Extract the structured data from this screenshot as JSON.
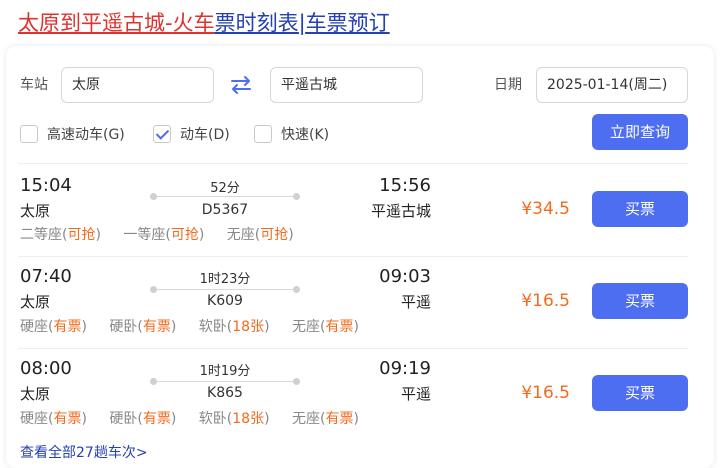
{
  "title": {
    "part1": "太原到平遥古城",
    "dash": "-",
    "part2": "火车",
    "part3": "票时刻表",
    "pipe": "|",
    "part4": "车票预订"
  },
  "search": {
    "station_label": "车站",
    "from": "太原",
    "to": "平遥古城",
    "date_label": "日期",
    "date": "2025-01-14(周二)",
    "button": "立即查询"
  },
  "filters": [
    {
      "label": "高速动车(G)",
      "checked": false
    },
    {
      "label": "动车(D)",
      "checked": true
    },
    {
      "label": "快速(K)",
      "checked": false
    }
  ],
  "trains": [
    {
      "depart_time": "15:04",
      "arrive_time": "15:56",
      "depart_station": "太原",
      "arrive_station": "平遥古城",
      "duration": "52分",
      "number": "D5367",
      "price": "¥34.5",
      "buy": "买票",
      "seats": [
        {
          "name": "二等座",
          "open": "(",
          "status": "可抢",
          "close": ")"
        },
        {
          "name": "一等座",
          "open": "(",
          "status": "可抢",
          "close": ")"
        },
        {
          "name": "无座",
          "open": "(",
          "status": "可抢",
          "close": ")"
        }
      ]
    },
    {
      "depart_time": "07:40",
      "arrive_time": "09:03",
      "depart_station": "太原",
      "arrive_station": "平遥",
      "duration": "1时23分",
      "number": "K609",
      "price": "¥16.5",
      "buy": "买票",
      "seats": [
        {
          "name": "硬座",
          "open": "(",
          "status": "有票",
          "close": ")"
        },
        {
          "name": "硬卧",
          "open": "(",
          "status": "有票",
          "close": ")"
        },
        {
          "name": "软卧",
          "open": "(",
          "status": "18张",
          "close": ")"
        },
        {
          "name": "无座",
          "open": "(",
          "status": "有票",
          "close": ")"
        }
      ]
    },
    {
      "depart_time": "08:00",
      "arrive_time": "09:19",
      "depart_station": "太原",
      "arrive_station": "平遥",
      "duration": "1时19分",
      "number": "K865",
      "price": "¥16.5",
      "buy": "买票",
      "seats": [
        {
          "name": "硬座",
          "open": "(",
          "status": "有票",
          "close": ")"
        },
        {
          "name": "硬卧",
          "open": "(",
          "status": "有票",
          "close": ")"
        },
        {
          "name": "软卧",
          "open": "(",
          "status": "18张",
          "close": ")"
        },
        {
          "name": "无座",
          "open": "(",
          "status": "有票",
          "close": ")"
        }
      ]
    }
  ],
  "more_link": "查看全部27趟车次>",
  "colors": {
    "accent": "#4e6ef2",
    "price": "#f46a1d",
    "title_red": "#e0312e",
    "title_blue": "#2440b3"
  },
  "icons": {
    "swap": "swap-arrows-icon",
    "check": "checkmark-icon"
  }
}
